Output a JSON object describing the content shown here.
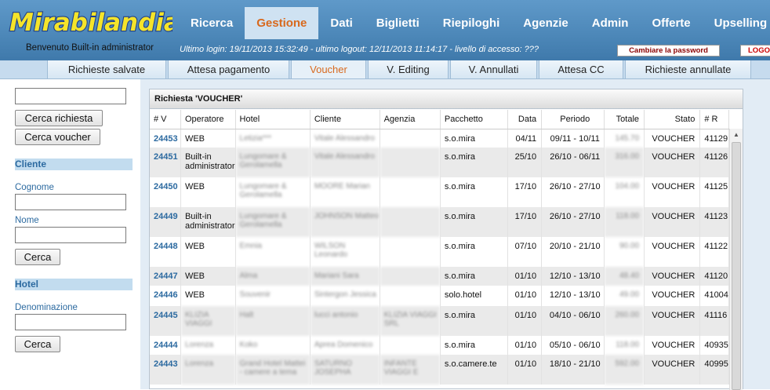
{
  "app": {
    "logo_text": "Mirabilandia"
  },
  "nav": {
    "items": [
      {
        "label": "Ricerca"
      },
      {
        "label": "Gestione"
      },
      {
        "label": "Dati"
      },
      {
        "label": "Biglietti"
      },
      {
        "label": "Riepiloghi"
      },
      {
        "label": "Agenzie"
      },
      {
        "label": "Admin"
      },
      {
        "label": "Offerte"
      },
      {
        "label": "Upselling"
      }
    ],
    "active": "Gestione"
  },
  "header": {
    "welcome": "Benvenuto Built-in administrator",
    "last_login": "Ultimo login: 19/11/2013 15:32:49 - ultimo logout: 12/11/2013 11:14:17 - livello di accesso: ???",
    "change_password": "Cambiare la password",
    "logout": "LOGOUT"
  },
  "subtabs": {
    "items": [
      {
        "label": "Richieste salvate"
      },
      {
        "label": "Attesa pagamento"
      },
      {
        "label": "Voucher"
      },
      {
        "label": "V. Editing"
      },
      {
        "label": "V. Annullati"
      },
      {
        "label": "Attesa CC"
      },
      {
        "label": "Richieste annullate"
      }
    ],
    "active": "Voucher"
  },
  "sidebar": {
    "search_value": "",
    "cerca_richiesta": "Cerca richiesta",
    "cerca_voucher": "Cerca voucher",
    "cliente_heading": "Cliente",
    "cognome_label": "Cognome",
    "nome_label": "Nome",
    "cerca_cliente": "Cerca",
    "hotel_heading": "Hotel",
    "denominazione_label": "Denominazione",
    "cerca_hotel": "Cerca"
  },
  "panel": {
    "title": "Richiesta 'VOUCHER'"
  },
  "table": {
    "columns": [
      "# V",
      "Operatore",
      "Hotel",
      "Cliente",
      "Agenzia",
      "Pacchetto",
      "Data",
      "Periodo",
      "Totale",
      "Stato",
      "# R"
    ],
    "rows": [
      {
        "v": "24453",
        "operatore": "WEB",
        "hotel": "Letizia***",
        "cliente": "Vitale Alessandro",
        "agenzia": "",
        "pacchetto": "s.o.mira",
        "data": "04/11",
        "periodo": "09/11 - 10/11",
        "totale": "145.70",
        "stato": "VOUCHER",
        "r": "41129"
      },
      {
        "v": "24451",
        "operatore": "Built-in administrator",
        "hotel": "Lungomare & Gerolamella",
        "cliente": "Vitale Alessandro",
        "agenzia": "",
        "pacchetto": "s.o.mira",
        "data": "25/10",
        "periodo": "26/10 - 06/11",
        "totale": "316.00",
        "stato": "VOUCHER",
        "r": "41126"
      },
      {
        "v": "24450",
        "operatore": "WEB",
        "hotel": "Lungomare & Gerolamella",
        "cliente": "MOORE Marian",
        "agenzia": "",
        "pacchetto": "s.o.mira",
        "data": "17/10",
        "periodo": "26/10 - 27/10",
        "totale": "104.00",
        "stato": "VOUCHER",
        "r": "41125"
      },
      {
        "v": "24449",
        "operatore": "Built-in administrator",
        "hotel": "Lungomare & Gerolamella",
        "cliente": "JOHNSON Matteo",
        "agenzia": "",
        "pacchetto": "s.o.mira",
        "data": "17/10",
        "periodo": "26/10 - 27/10",
        "totale": "118.00",
        "stato": "VOUCHER",
        "r": "41123"
      },
      {
        "v": "24448",
        "operatore": "WEB",
        "hotel": "Emnia",
        "cliente": "WILSON Leonardo",
        "agenzia": "",
        "pacchetto": "s.o.mira",
        "data": "07/10",
        "periodo": "20/10 - 21/10",
        "totale": "90.00",
        "stato": "VOUCHER",
        "r": "41122"
      },
      {
        "v": "24447",
        "operatore": "WEB",
        "hotel": "Alma",
        "cliente": "Mariani Sara",
        "agenzia": "",
        "pacchetto": "s.o.mira",
        "data": "01/10",
        "periodo": "12/10 - 13/10",
        "totale": "48.40",
        "stato": "VOUCHER",
        "r": "41120"
      },
      {
        "v": "24446",
        "operatore": "WEB",
        "hotel": "Souvenir",
        "cliente": "Sintergon Jessica",
        "agenzia": "",
        "pacchetto": "solo.hotel",
        "data": "01/10",
        "periodo": "12/10 - 13/10",
        "totale": "49.00",
        "stato": "VOUCHER",
        "r": "41004"
      },
      {
        "v": "24445",
        "operatore": "KLIZIA VIAGGI",
        "hotel": "Halt",
        "cliente": "lucci antonio",
        "agenzia": "KLIZIA VIAGGI SRL",
        "pacchetto": "s.o.mira",
        "data": "01/10",
        "periodo": "04/10 - 06/10",
        "totale": "260.00",
        "stato": "VOUCHER",
        "r": "41116"
      },
      {
        "v": "24444",
        "operatore": "Lorenza",
        "hotel": "Koko",
        "cliente": "Aprea Domenico",
        "agenzia": "",
        "pacchetto": "s.o.mira",
        "data": "01/10",
        "periodo": "05/10 - 06/10",
        "totale": "118.00",
        "stato": "VOUCHER",
        "r": "40935"
      },
      {
        "v": "24443",
        "operatore": "Lorenza",
        "hotel": "Grand Hotel Mattei - camere a tema",
        "cliente": "SATURNO JOSEPHA",
        "agenzia": "INFANTE VIAGGI E",
        "pacchetto": "s.o.camere.te",
        "data": "01/10",
        "periodo": "18/10 - 21/10",
        "totale": "592.00",
        "stato": "VOUCHER",
        "r": "40995"
      }
    ]
  },
  "colors": {
    "accent": "#d8691e",
    "header_blue": "#4c87b8",
    "link_blue": "#2c6aa0"
  }
}
